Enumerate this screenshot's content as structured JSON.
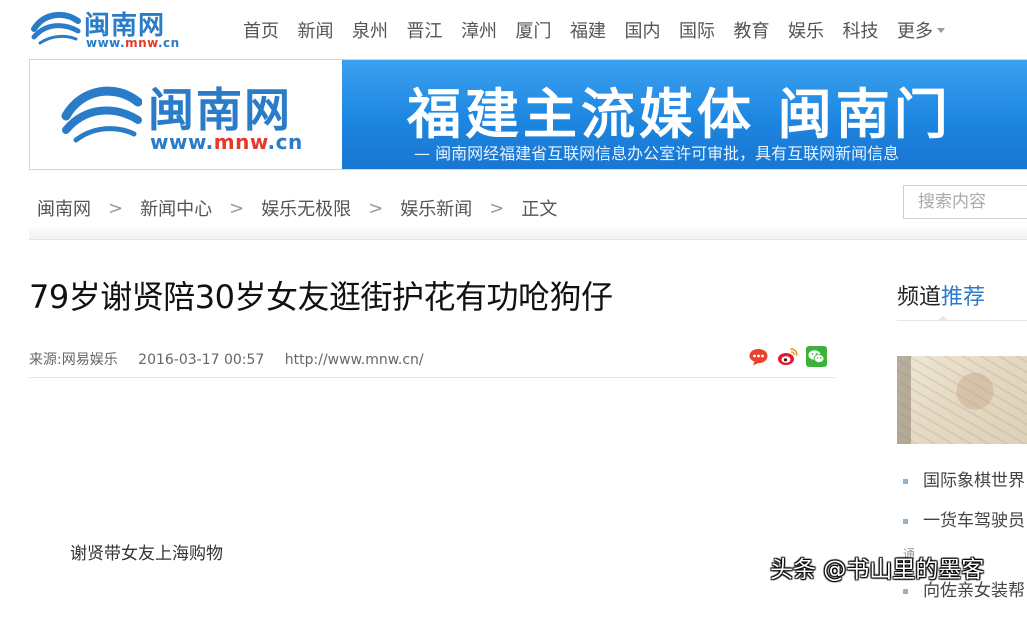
{
  "site": {
    "logo_text": "闽南网",
    "logo_url_prefix": "www.",
    "logo_url_brand": "mnw",
    "logo_url_suffix": ".cn"
  },
  "nav": {
    "items": [
      "首页",
      "新闻",
      "泉州",
      "晋江",
      "漳州",
      "厦门",
      "福建",
      "国内",
      "国际",
      "教育",
      "娱乐",
      "科技"
    ],
    "more_label": "更多"
  },
  "banner": {
    "slogan": "福建主流媒体  闽南门",
    "license": "— 闽南网经福建省互联网信息办公室许可审批，具有互联网新闻信息"
  },
  "breadcrumb": {
    "items": [
      "闽南网",
      "新闻中心",
      "娱乐无极限",
      "娱乐新闻",
      "正文"
    ],
    "separator": ">"
  },
  "search": {
    "placeholder": "搜索内容"
  },
  "article": {
    "title": "79岁谢贤陪30岁女友逛街护花有功呛狗仔",
    "source": "来源:网易娱乐",
    "datetime": "2016-03-17 00:57",
    "url": "http://www.mnw.cn/",
    "image_caption": "谢贤带女友上海购物"
  },
  "share": {
    "icons": [
      "comment-icon",
      "weibo-icon",
      "wechat-icon"
    ]
  },
  "sidebar": {
    "title_prefix": "频道",
    "title_highlight": "推荐",
    "list": [
      "国际象棋世界",
      "一货车驾驶员",
      "向佐亲女装帮"
    ],
    "fragment": "通"
  },
  "watermark": "头条 @书山里的墨客",
  "colors": {
    "brand_blue": "#2b7cc8",
    "brand_red": "#e43a2c",
    "banner_blue": "#1d86e0"
  }
}
